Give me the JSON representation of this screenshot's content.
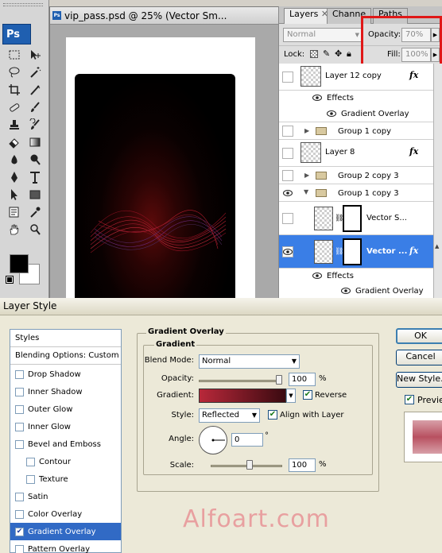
{
  "photoshop": {
    "logo": "Ps"
  },
  "document": {
    "title": "vip_pass.psd @ 25% (Vector Sm..."
  },
  "layers_panel": {
    "tabs": [
      "Layers",
      "Channe",
      "Paths"
    ],
    "blend_mode": "Normal",
    "opacity_label": "Opacity:",
    "opacity_value": "70%",
    "lock_label": "Lock:",
    "fill_label": "Fill:",
    "fill_value": "100%",
    "layers": [
      {
        "name": "Layer 12 copy",
        "fx": "fx"
      },
      {
        "name": "Effects"
      },
      {
        "name": "Gradient Overlay"
      },
      {
        "name": "Group 1 copy"
      },
      {
        "name": "Layer 8",
        "fx": "fx"
      },
      {
        "name": "Group 2 copy 3"
      },
      {
        "name": "Group 1 copy 3"
      },
      {
        "name": "Vector S..."
      },
      {
        "name": "Vector ...",
        "fx": "fx"
      },
      {
        "name": "Effects"
      },
      {
        "name": "Gradient Overlay"
      }
    ]
  },
  "dialog": {
    "title": "Layer Style",
    "styles_header": "Styles",
    "blending_options": "Blending Options: Custom",
    "style_items": [
      {
        "label": "Drop Shadow",
        "checked": false
      },
      {
        "label": "Inner Shadow",
        "checked": false
      },
      {
        "label": "Outer Glow",
        "checked": false
      },
      {
        "label": "Inner Glow",
        "checked": false
      },
      {
        "label": "Bevel and Emboss",
        "checked": false
      },
      {
        "label": "Contour",
        "checked": false
      },
      {
        "label": "Texture",
        "checked": false
      },
      {
        "label": "Satin",
        "checked": false
      },
      {
        "label": "Color Overlay",
        "checked": false
      },
      {
        "label": "Gradient Overlay",
        "checked": true
      },
      {
        "label": "Pattern Overlay",
        "checked": false
      }
    ],
    "section_title": "Gradient Overlay",
    "subsection_title": "Gradient",
    "blend_mode_label": "Blend Mode:",
    "blend_mode_value": "Normal",
    "opacity_label": "Opacity:",
    "opacity_value": "100",
    "opacity_unit": "%",
    "opacity_level": 1.0,
    "gradient_label": "Gradient:",
    "gradient_colors": [
      "#b8283a",
      "#3a0a10"
    ],
    "reverse_label": "Reverse",
    "reverse_checked": true,
    "style_label": "Style:",
    "style_value": "Reflected",
    "align_label": "Align with Layer",
    "align_checked": true,
    "angle_label": "Angle:",
    "angle_value": "0",
    "angle_unit": "°",
    "scale_label": "Scale:",
    "scale_value": "100",
    "scale_unit": "%",
    "buttons": {
      "ok": "OK",
      "cancel": "Cancel",
      "new_style": "New Style...",
      "preview": "Preview"
    },
    "preview_checked": true,
    "preview_color": "#b85060"
  },
  "watermark": "Alfoart.com"
}
